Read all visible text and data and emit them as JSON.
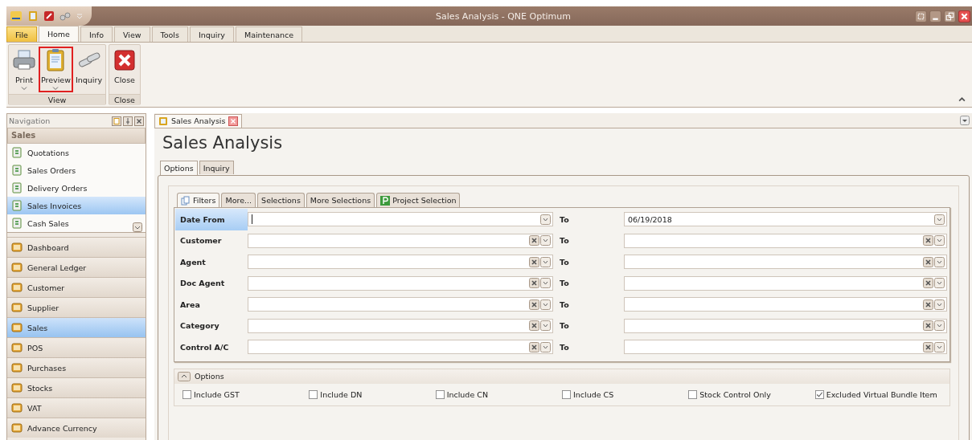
{
  "window": {
    "title": "Sales Analysis - QNE Optimum"
  },
  "ribbon_tabs": [
    {
      "label": "File",
      "selected": false,
      "kind": "file"
    },
    {
      "label": "Home",
      "selected": true,
      "kind": "tab"
    },
    {
      "label": "Info",
      "selected": false,
      "kind": "tab"
    },
    {
      "label": "View",
      "selected": false,
      "kind": "tab"
    },
    {
      "label": "Tools",
      "selected": false,
      "kind": "tab"
    },
    {
      "label": "Inquiry",
      "selected": false,
      "kind": "tab"
    },
    {
      "label": "Maintenance",
      "selected": false,
      "kind": "tab"
    }
  ],
  "ribbon_groups": [
    {
      "label": "View",
      "buttons": [
        {
          "label": "Print",
          "kind": "print",
          "dropdown": true,
          "highlighted": false
        },
        {
          "label": "Preview",
          "kind": "preview",
          "dropdown": true,
          "highlighted": true
        },
        {
          "label": "Inquiry",
          "kind": "inquiry",
          "dropdown": false,
          "highlighted": false
        }
      ]
    },
    {
      "label": "Close",
      "buttons": [
        {
          "label": "Close",
          "kind": "close",
          "dropdown": false,
          "highlighted": false
        }
      ]
    }
  ],
  "navigation": {
    "title": "Navigation",
    "section": "Sales",
    "items": [
      {
        "label": "Quotations",
        "selected": false
      },
      {
        "label": "Sales Orders",
        "selected": false
      },
      {
        "label": "Delivery Orders",
        "selected": false
      },
      {
        "label": "Sales Invoices",
        "selected": true
      },
      {
        "label": "Cash Sales",
        "selected": false
      }
    ],
    "modules": [
      {
        "label": "Dashboard",
        "selected": false
      },
      {
        "label": "General Ledger",
        "selected": false
      },
      {
        "label": "Customer",
        "selected": false
      },
      {
        "label": "Supplier",
        "selected": false
      },
      {
        "label": "Sales",
        "selected": true
      },
      {
        "label": "POS",
        "selected": false
      },
      {
        "label": "Purchases",
        "selected": false
      },
      {
        "label": "Stocks",
        "selected": false
      },
      {
        "label": "VAT",
        "selected": false
      },
      {
        "label": "Advance Currency",
        "selected": false
      }
    ]
  },
  "document_tab": {
    "label": "Sales Analysis"
  },
  "heading": "Sales Analysis",
  "page_tabs": [
    {
      "label": "Options",
      "selected": true
    },
    {
      "label": "Inquiry",
      "selected": false
    }
  ],
  "filter_tabs": [
    {
      "label": "Filters",
      "selected": true,
      "kind": "filters"
    },
    {
      "label": "More...",
      "selected": false,
      "kind": "plain"
    },
    {
      "label": "Selections",
      "selected": false,
      "kind": "plain"
    },
    {
      "label": "More Selections",
      "selected": false,
      "kind": "plain"
    },
    {
      "label": "Project Selection",
      "selected": false,
      "kind": "project"
    }
  ],
  "filters": [
    {
      "label": "Date From",
      "selected": true,
      "clearable": false,
      "to_label": "To",
      "to_value": "06/19/2018"
    },
    {
      "label": "Customer",
      "selected": false,
      "clearable": true,
      "to_label": "To"
    },
    {
      "label": "Agent",
      "selected": false,
      "clearable": true,
      "to_label": "To"
    },
    {
      "label": "Doc Agent",
      "selected": false,
      "clearable": true,
      "to_label": "To"
    },
    {
      "label": "Area",
      "selected": false,
      "clearable": true,
      "to_label": "To"
    },
    {
      "label": "Category",
      "selected": false,
      "clearable": true,
      "to_label": "To"
    },
    {
      "label": "Control A/C",
      "selected": false,
      "clearable": true,
      "to_label": "To"
    }
  ],
  "options": {
    "title": "Options",
    "expanded": true,
    "checkboxes": [
      {
        "label": "Include GST",
        "checked": false
      },
      {
        "label": "Include DN",
        "checked": false
      },
      {
        "label": "Include CN",
        "checked": false
      },
      {
        "label": "Include CS",
        "checked": false
      },
      {
        "label": "Stock Control Only",
        "checked": false
      },
      {
        "label": "Excluded Virtual Bundle Item",
        "checked": true
      }
    ]
  }
}
